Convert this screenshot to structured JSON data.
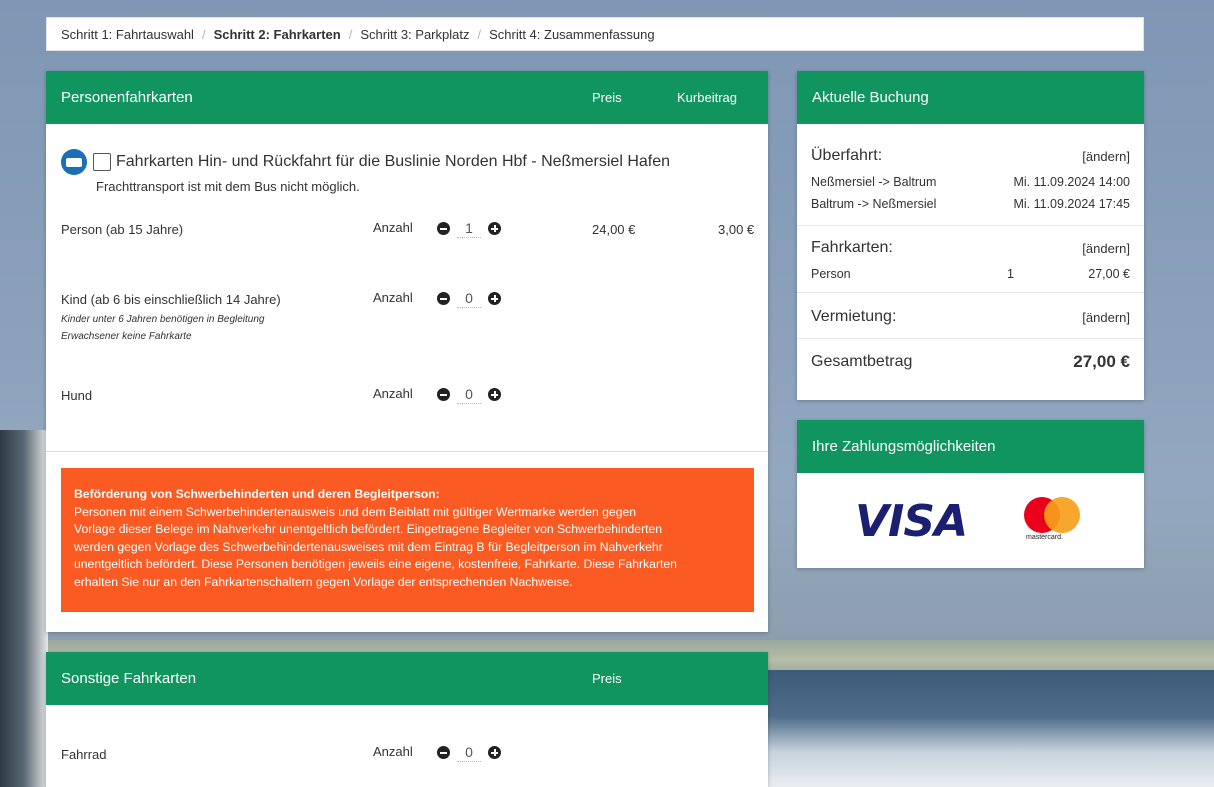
{
  "breadcrumb": {
    "step1": "Schritt 1: Fahrtauswahl",
    "step2": "Schritt 2: Fahrkarten",
    "step3": "Schritt 3: Parkplatz",
    "step4": "Schritt 4: Zusammenfassung",
    "separator": "/"
  },
  "tickets": {
    "header": "Personenfahrkarten",
    "col_price": "Preis",
    "col_kurbeitrag": "Kurbeitrag",
    "bus_icon": "bus-icon",
    "bus_title": "Fahrkarten Hin- und Rückfahrt für die Buslinie Norden Hbf - Neßmersiel Hafen",
    "bus_note": "Frachttransport ist mit dem Bus nicht möglich.",
    "rows": [
      {
        "label": "Person (ab 15 Jahre)",
        "anzahl_label": "Anzahl",
        "qty": "1",
        "price": "24,00 €",
        "kurbeitrag": "3,00 €"
      },
      {
        "label": "Kind (ab 6 bis einschließlich 14 Jahre)",
        "anzahl_label": "Anzahl",
        "qty": "0",
        "sub1": "Kinder unter 6 Jahren benötigen in Begleitung",
        "sub2": "Erwachsener keine Fahrkarte"
      },
      {
        "label": "Hund",
        "anzahl_label": "Anzahl",
        "qty": "0"
      }
    ],
    "warning": {
      "title": "Beförderung von Schwerbehinderten und deren Begleitperson:",
      "line1": "Personen mit einem Schwerbehindertenausweis und dem Beiblatt mit gültiger Wertmarke werden gegen",
      "line2": "Vorlage dieser Belege im Nahverkehr unentgeltlich befördert. Eingetragene Begleiter von Schwerbehinderten",
      "line3": "werden gegen Vorlage des Schwerbehindertenausweises mit dem Eintrag B für Begleitperson im Nahverkehr",
      "line4": "unentgeltlich befördert. Diese Personen benötigen jeweils eine eigene, kostenfreie, Fahrkarte. Diese Fahrkarten",
      "line5": "erhalten Sie nur an den Fahrkartenschaltern gegen Vorlage der entsprechenden Nachweise."
    }
  },
  "other": {
    "header": "Sonstige Fahrkarten",
    "col_price": "Preis",
    "rows": [
      {
        "label": "Fahrrad",
        "anzahl_label": "Anzahl",
        "qty": "0"
      }
    ]
  },
  "booking": {
    "header": "Aktuelle Buchung",
    "crossing_title": "Überfahrt:",
    "change": "[ändern]",
    "trips": [
      {
        "route": "Neßmersiel -> Baltrum",
        "datetime": "Mi. 11.09.2024 14:00"
      },
      {
        "route": "Baltrum -> Neßmersiel",
        "datetime": "Mi. 11.09.2024 17:45"
      }
    ],
    "tickets_title": "Fahrkarten:",
    "ticket_line": {
      "label": "Person",
      "qty": "1",
      "amount": "27,00 €"
    },
    "rental_title": "Vermietung:",
    "total_label": "Gesamtbetrag",
    "total_amount": "27,00 €"
  },
  "payment": {
    "header": "Ihre Zahlungsmöglichkeiten",
    "visa": "VISA",
    "mastercard": "mastercard."
  },
  "colors": {
    "header_green": "#10955f",
    "warning_orange": "#fb5b22",
    "bus_blue": "#1a6fb5",
    "visa_blue": "#1a1f71"
  }
}
